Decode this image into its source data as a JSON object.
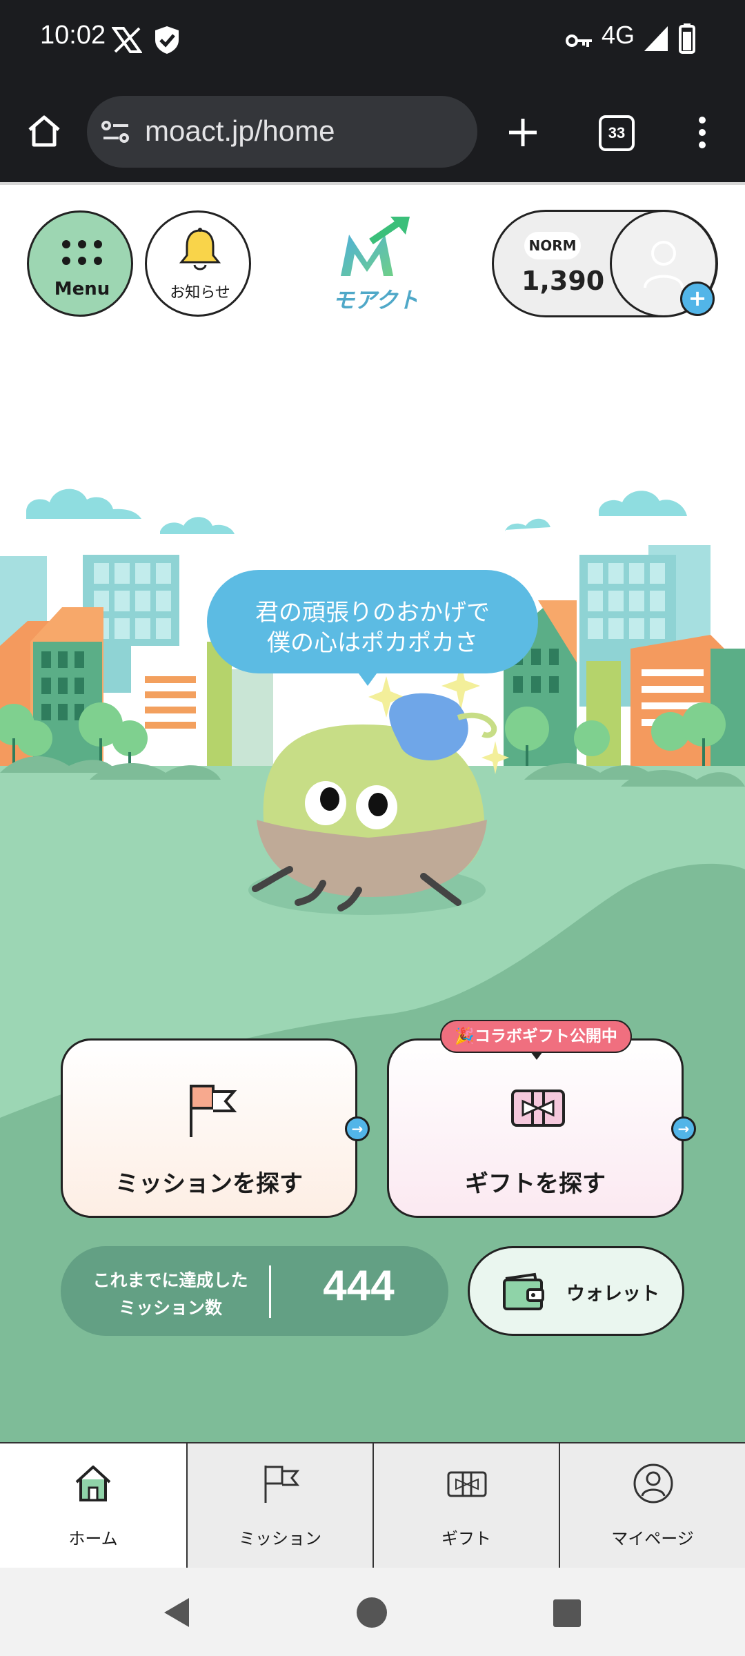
{
  "status_bar": {
    "time": "10:02",
    "network": "4G"
  },
  "browser": {
    "url": "moact.jp/home",
    "tab_count": "33"
  },
  "header": {
    "menu_label": "Menu",
    "notice_label": "お知らせ",
    "logo_text": "モアクト",
    "points": {
      "tag": "NORM",
      "value": "1,390"
    }
  },
  "speech": {
    "line1": "君の頑張りのおかげで",
    "line2": "僕の心はポカポカさ"
  },
  "cards": {
    "mission": {
      "label": "ミッションを探す"
    },
    "gift": {
      "label": "ギフトを探す",
      "badge": "コラボギフト公開中"
    }
  },
  "stats": {
    "label_line1": "これまでに達成した",
    "label_line2": "ミッション数",
    "value": "444"
  },
  "wallet": {
    "label": "ウォレット"
  },
  "bottom_nav": [
    {
      "label": "ホーム",
      "active": true
    },
    {
      "label": "ミッション",
      "active": false
    },
    {
      "label": "ギフト",
      "active": false
    },
    {
      "label": "マイページ",
      "active": false
    }
  ],
  "colors": {
    "menu_green": "#9dd6b2",
    "accent_blue": "#52b5e8",
    "speech_blue": "#5cbbe3",
    "badge_pink": "#f06f7f",
    "stats_green": "#63a084",
    "ground_green": "#9cd6b4",
    "ground_dark": "#7ebc98"
  }
}
